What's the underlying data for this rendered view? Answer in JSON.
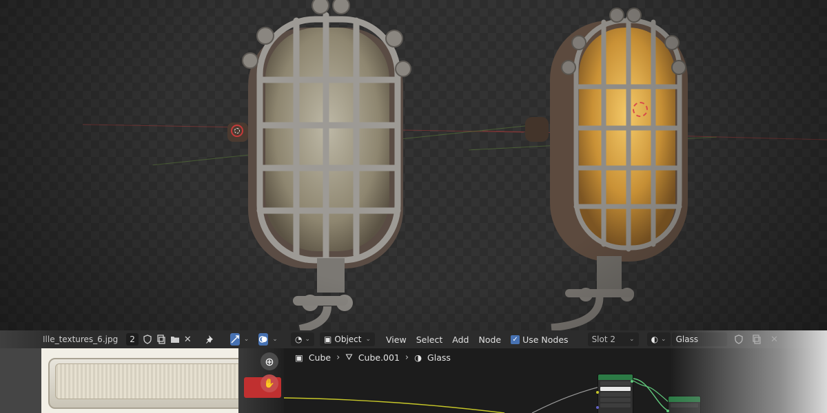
{
  "image_editor": {
    "filename": "Ille_textures_6.jpg",
    "users_count": "2",
    "icons": [
      "shield-icon",
      "copy-icon",
      "folder-icon",
      "close-icon",
      "pin-icon",
      "uv-sync-icon",
      "overlay-icon",
      "display-icon"
    ]
  },
  "node_editor": {
    "editor_type_icon": "shader-editor-icon",
    "mode": "Object",
    "menu": [
      "View",
      "Select",
      "Add",
      "Node"
    ],
    "use_nodes_label": "Use Nodes",
    "use_nodes_checked": true,
    "slot": "Slot 2",
    "material_name": "Glass",
    "breadcrumbs": [
      {
        "label": "Cube",
        "icon": "object-icon"
      },
      {
        "label": "Cube.001",
        "icon": "mesh-icon"
      },
      {
        "label": "Glass",
        "icon": "material-icon"
      }
    ]
  },
  "colors": {
    "accent_blue": "#4772b3",
    "header_bg": "#2c2c2c",
    "node_green": "#2c7a45",
    "axis_red": "#c63a3a"
  }
}
